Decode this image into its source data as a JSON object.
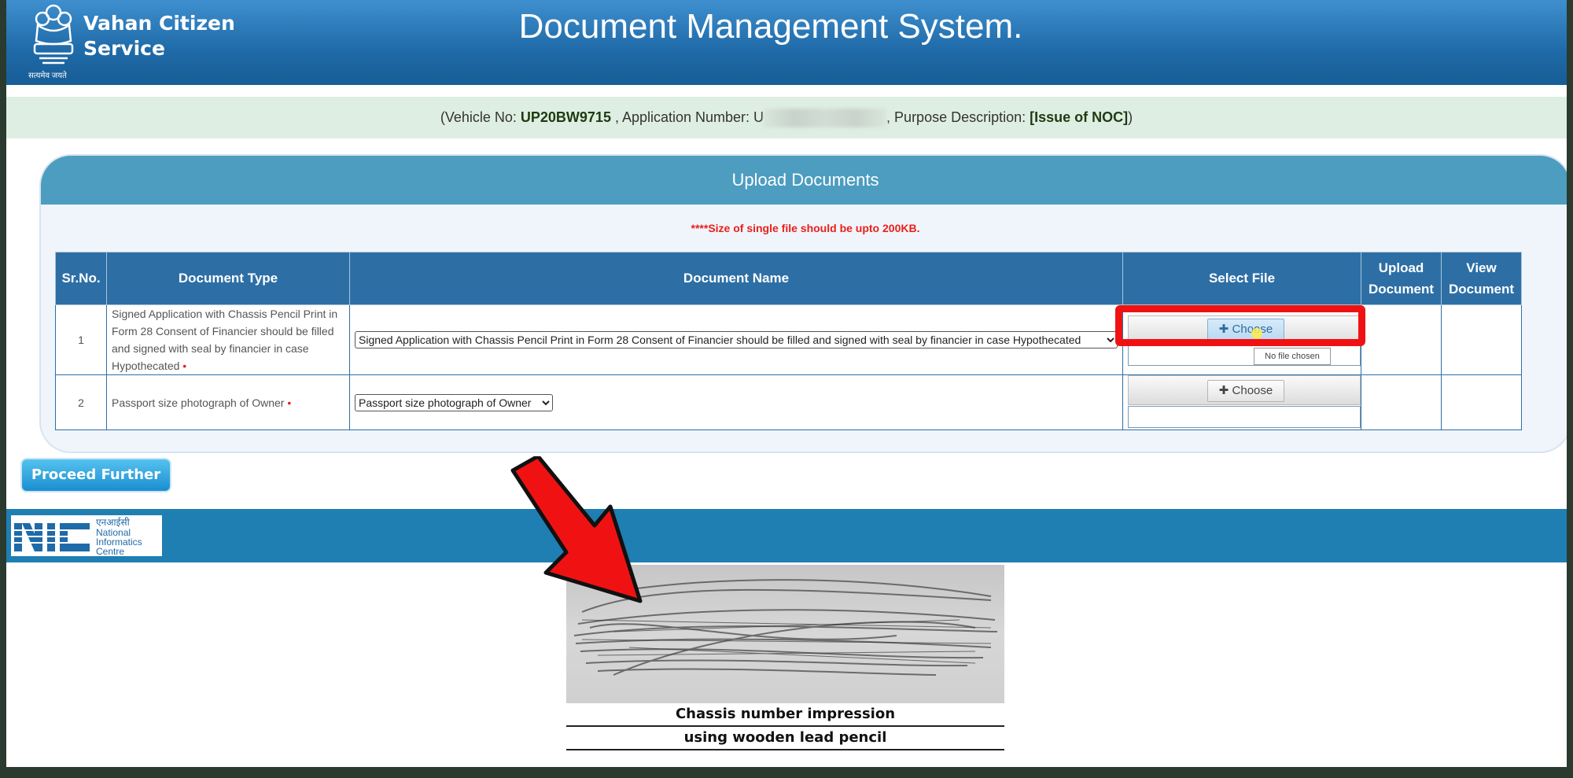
{
  "header": {
    "brand_line1": "Vahan Citizen",
    "brand_line2": "Service",
    "emblem_tagline": "सत्यमेव जयते",
    "title": "Document Management System."
  },
  "info_band": {
    "prefix": "(Vehicle No: ",
    "vehicle_no": "UP20BW9715",
    "app_label": " , Application Number: ",
    "app_number_visible": "U",
    "purpose_label": ", Purpose Description: ",
    "purpose": "[Issue of NOC]",
    "suffix": ")"
  },
  "panel": {
    "title": "Upload Documents",
    "size_note": "****Size of single file should be upto 200KB."
  },
  "table": {
    "headers": [
      "Sr.No.",
      "Document Type",
      "Document Name",
      "Select File",
      "Upload Document",
      "View Document"
    ],
    "rows": [
      {
        "sr": "1",
        "doc_type": "Signed Application with Chassis Pencil Print in Form 28 Consent of Financier should be filled and signed with seal by financier in case Hypothecated",
        "doc_name": "Signed Application with Chassis Pencil Print in Form 28 Consent of Financier should be filled and signed with seal by financier in case Hypothecated",
        "choose_label": "Choose",
        "tooltip": "No file chosen"
      },
      {
        "sr": "2",
        "doc_type": "Passport size photograph of Owner",
        "doc_name": "Passport size photograph of Owner",
        "choose_label": "Choose"
      }
    ],
    "required_marker": "•"
  },
  "proceed_button": "Proceed Further",
  "footer": {
    "nic_hindi": "एनआईसी",
    "nic_line1": "National",
    "nic_line2": "Informatics",
    "nic_line3": "Centre"
  },
  "overlay": {
    "caption_line1": "Chassis number impression",
    "caption_line2": "using  wooden lead pencil",
    "arrow_color": "#f01212",
    "highlight_color": "#f01212"
  }
}
